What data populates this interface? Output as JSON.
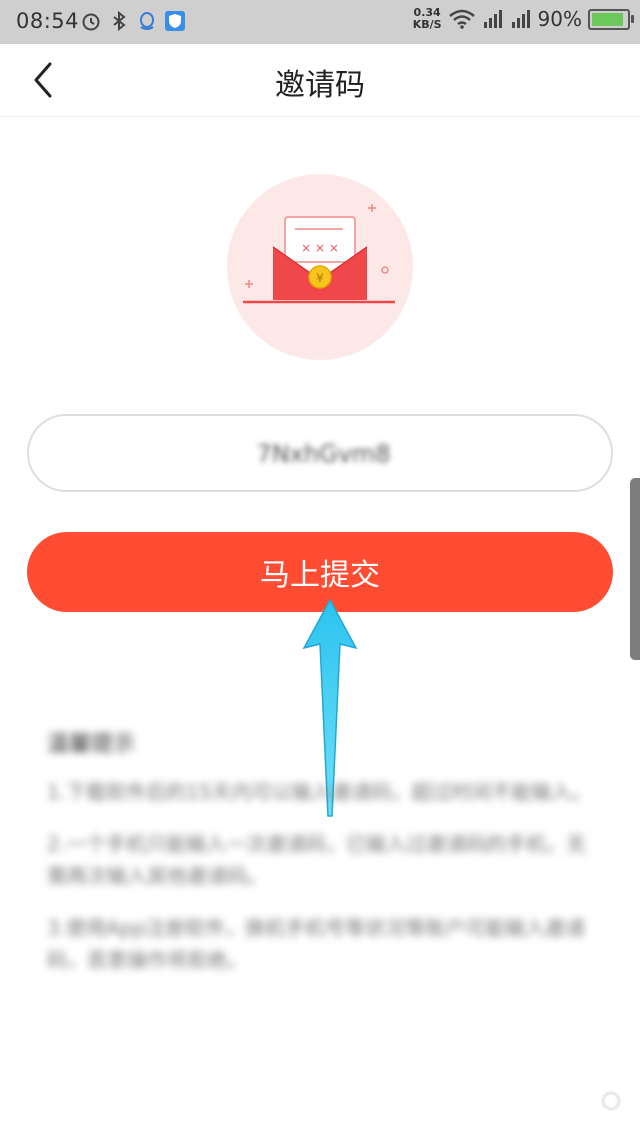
{
  "status_bar": {
    "time": "08:54",
    "speed_value": "0.34",
    "speed_unit": "KB/S",
    "battery": "90%",
    "icons": [
      "alarm-icon",
      "bluetooth-icon",
      "qq-icon",
      "shield-icon",
      "wifi-icon",
      "signal-icon",
      "signal-4g-icon",
      "battery-icon"
    ]
  },
  "nav": {
    "title": "邀请码",
    "back_icon": "chevron-left-icon"
  },
  "invite": {
    "illustration": "red-envelope-icon",
    "input_value": "7NxhGvm8",
    "submit_label": "马上提交"
  },
  "notes": {
    "title": "温馨提示",
    "items": [
      "1.下载软件后的15天内可以输入邀请码，超过时间不能输入。",
      "2.一个手机只能输入一次邀请码，已输入过邀请码的手机，无需再次输入其他邀请码。",
      "3.使用App注册软件，换机手机号等状况等账户可能输入邀请码，恶意操作将拒绝。"
    ]
  },
  "colors": {
    "accent": "#ff4c33",
    "statusbar_bg": "#cfcfcf",
    "annotation_arrow": "#3fd0f0"
  }
}
